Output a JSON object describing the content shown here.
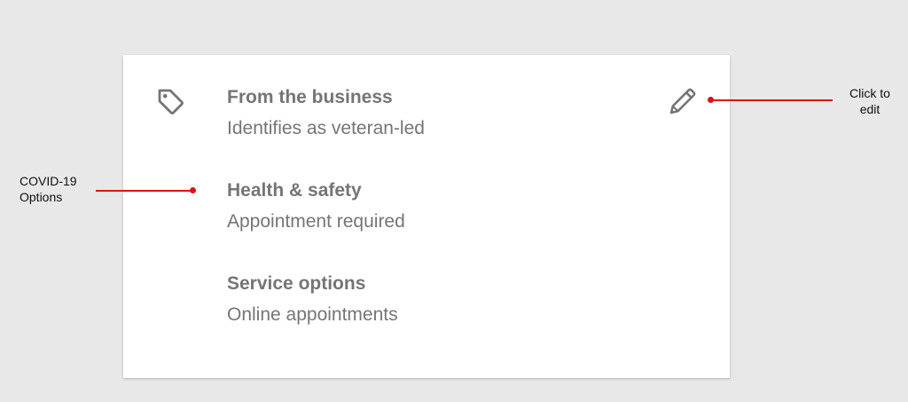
{
  "card": {
    "items": [
      {
        "title": "From the business",
        "value": "Identifies as veteran-led"
      },
      {
        "title": "Health & safety",
        "value": "Appointment required"
      },
      {
        "title": "Service options",
        "value": "Online appointments"
      }
    ],
    "icons": {
      "left": "tag-icon",
      "right": "pencil-edit-icon"
    }
  },
  "annotations": {
    "left": {
      "line1": "COVID-19",
      "line2": "Options"
    },
    "right": {
      "line1": "Click to",
      "line2": "edit"
    }
  },
  "colors": {
    "background": "#e8e8e8",
    "card": "#ffffff",
    "text": "#757575",
    "annotation_arrow": "#e0101a",
    "annotation_text": "#111111"
  }
}
